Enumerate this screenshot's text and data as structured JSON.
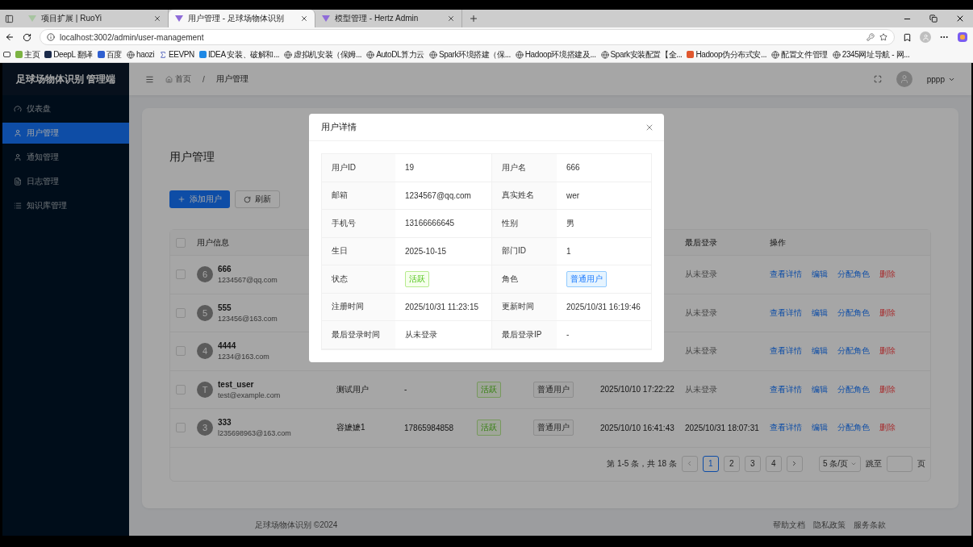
{
  "browser": {
    "tabs": [
      {
        "title": "项目扩展 | RuoYi",
        "selected": false
      },
      {
        "title": "用户管理 - 足球场物体识别",
        "selected": true
      },
      {
        "title": "模型管理 - Hertz Admin",
        "selected": false
      }
    ],
    "address": "localhost:3002/admin/user-management",
    "bookmarks": [
      {
        "label": "主页",
        "kind": "favicon",
        "color": "#7cb342"
      },
      {
        "label": "DeepL 翻译",
        "kind": "favicon",
        "color": "#1b2a4a"
      },
      {
        "label": "百度",
        "kind": "favicon",
        "color": "#2f5fd0"
      },
      {
        "label": "haozi",
        "kind": "globe"
      },
      {
        "label": "EEVPN",
        "kind": "sigma"
      },
      {
        "label": "IDEA 安装、破解和...",
        "kind": "favicon",
        "color": "#1e88e5"
      },
      {
        "label": "虚拟机安装（保姆...",
        "kind": "globe"
      },
      {
        "label": "AutoDL算力云",
        "kind": "globe"
      },
      {
        "label": "Spark环境搭建（保...",
        "kind": "globe"
      },
      {
        "label": "Hadoop环境搭建及...",
        "kind": "globe"
      },
      {
        "label": "Spark安装配置【全...",
        "kind": "globe"
      },
      {
        "label": "Hadoop伪分布式安...",
        "kind": "favicon",
        "color": "#e0572e"
      },
      {
        "label": "配置文件管理",
        "kind": "globe"
      },
      {
        "label": "2345网址导航 - 网...",
        "kind": "globe"
      }
    ]
  },
  "sidebar": {
    "title": "足球场物体识别 管理端",
    "items": [
      {
        "label": "仪表盘",
        "kind": "dashboard",
        "selected": false
      },
      {
        "label": "用户管理",
        "kind": "user",
        "selected": true
      },
      {
        "label": "通知管理",
        "kind": "user",
        "selected": false
      },
      {
        "label": "日志管理",
        "kind": "file",
        "selected": false
      },
      {
        "label": "知识库管理",
        "kind": "list",
        "selected": false
      }
    ]
  },
  "header": {
    "breadcrumb": [
      "首页",
      "用户管理"
    ],
    "breadcrumb_separator": "/",
    "user": "pppp"
  },
  "page": {
    "title": "用户管理",
    "buttons": [
      {
        "label": "添加用户",
        "kind": "primary"
      },
      {
        "label": "刷新",
        "kind": "default"
      }
    ]
  },
  "table": {
    "header_checked": false,
    "columns": [
      "用户信息",
      null,
      null,
      null,
      null,
      null,
      "最后登录",
      "操作"
    ],
    "rows": [
      {
        "selected": false,
        "avatar": "6",
        "username": "666",
        "email": "1234567@qq.com",
        "last_login": "从未登录",
        "last_login_muted": true,
        "actions": [
          {
            "label": "查看详情",
            "kind": "link"
          },
          {
            "label": "编辑",
            "kind": "link"
          },
          {
            "label": "分配角色",
            "kind": "link"
          },
          {
            "label": "删除",
            "kind": "danger"
          }
        ]
      },
      {
        "selected": false,
        "avatar": "5",
        "username": "555",
        "email": "123456@163.com",
        "last_login": "从未登录",
        "last_login_muted": true,
        "actions": [
          {
            "label": "查看详情",
            "kind": "link"
          },
          {
            "label": "编辑",
            "kind": "link"
          },
          {
            "label": "分配角色",
            "kind": "link"
          },
          {
            "label": "删除",
            "kind": "danger"
          }
        ]
      },
      {
        "selected": false,
        "avatar": "4",
        "username": "4444",
        "email": "1234@163.com",
        "last_login": "从未登录",
        "last_login_muted": true,
        "actions": [
          {
            "label": "查看详情",
            "kind": "link"
          },
          {
            "label": "编辑",
            "kind": "link"
          },
          {
            "label": "分配角色",
            "kind": "link"
          },
          {
            "label": "删除",
            "kind": "danger"
          }
        ]
      },
      {
        "selected": false,
        "avatar": "T",
        "username": "test_user",
        "email": "test@example.com",
        "real_name": "测试用户",
        "phone": "-",
        "status": "活跃",
        "role": "普通用户",
        "created": "2025/10/10 17:22:22",
        "last_login": "从未登录",
        "last_login_muted": true,
        "actions": [
          {
            "label": "查看详情",
            "kind": "link"
          },
          {
            "label": "编辑",
            "kind": "link"
          },
          {
            "label": "分配角色",
            "kind": "link"
          },
          {
            "label": "删除",
            "kind": "danger"
          }
        ]
      },
      {
        "selected": false,
        "avatar": "3",
        "username": "333",
        "email": "l235698963@163.com",
        "real_name": "容嬷嬷1",
        "phone": "17865984858",
        "status": "活跃",
        "role": "普通用户",
        "created": "2025/10/10 16:41:43",
        "last_login": "2025/10/31 18:07:31",
        "last_login_muted": false,
        "actions": [
          {
            "label": "查看详情",
            "kind": "link"
          },
          {
            "label": "编辑",
            "kind": "link"
          },
          {
            "label": "分配角色",
            "kind": "link"
          },
          {
            "label": "删除",
            "kind": "danger"
          }
        ]
      }
    ]
  },
  "pagination": {
    "summary": "第 1-5 条，共 18 条",
    "pages": [
      {
        "label": "1",
        "selected": true
      },
      {
        "label": "2",
        "selected": false
      },
      {
        "label": "3",
        "selected": false
      },
      {
        "label": "4",
        "selected": false
      }
    ],
    "page_size": "5 条/页",
    "jump_label": "跳至",
    "jump_suffix": "页"
  },
  "footer": {
    "copyright": "足球场物体识别 ©2024",
    "links": [
      "帮助文档",
      "隐私政策",
      "服务条款"
    ]
  },
  "modal": {
    "title": "用户详情",
    "rows": [
      [
        {
          "label": "用户ID",
          "value": "19",
          "kind": "text"
        },
        {
          "label": "用户名",
          "value": "666",
          "kind": "text"
        }
      ],
      [
        {
          "label": "邮箱",
          "value": "1234567@qq.com",
          "kind": "text"
        },
        {
          "label": "真实姓名",
          "value": "wer",
          "kind": "text"
        }
      ],
      [
        {
          "label": "手机号",
          "value": "13166666645",
          "kind": "text"
        },
        {
          "label": "性别",
          "value": "男",
          "kind": "text"
        }
      ],
      [
        {
          "label": "生日",
          "value": "2025-10-15",
          "kind": "text"
        },
        {
          "label": "部门ID",
          "value": "1",
          "kind": "text"
        }
      ],
      [
        {
          "label": "状态",
          "value": "活跃",
          "kind": "success-tag"
        },
        {
          "label": "角色",
          "value": "普通用户",
          "kind": "info-tag"
        }
      ],
      [
        {
          "label": "注册时间",
          "value": "2025/10/31 11:23:15",
          "kind": "text"
        },
        {
          "label": "更新时间",
          "value": "2025/10/31 16:19:46",
          "kind": "text"
        }
      ],
      [
        {
          "label": "最后登录时间",
          "value": "从未登录",
          "kind": "text"
        },
        {
          "label": "最后登录IP",
          "value": "-",
          "kind": "text"
        }
      ]
    ]
  }
}
